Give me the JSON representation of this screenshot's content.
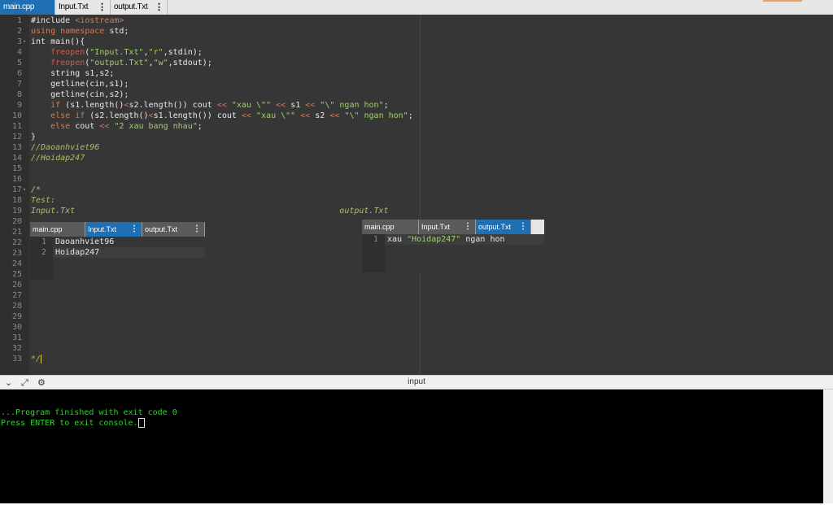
{
  "tabs": [
    {
      "label": "main.cpp",
      "active": true
    },
    {
      "label": "Input.Txt",
      "active": false
    },
    {
      "label": "output.Txt",
      "active": false
    }
  ],
  "menu_glyph": "⋮",
  "editor": {
    "lines": [
      {
        "n": "1",
        "html": "#include <span class='angle'>&lt;iostream&gt;</span>"
      },
      {
        "n": "2",
        "html": "<span class='angle'>using namespace</span> std;"
      },
      {
        "n": "3",
        "html": "int main(){"
      },
      {
        "n": "4",
        "html": "    <span class='red'>freopen</span>(<span class='str'>\"Input.Txt\"</span>,<span class='str'>\"r\"</span>,stdin);"
      },
      {
        "n": "5",
        "html": "    <span class='red'>freopen</span>(<span class='str'>\"output.Txt\"</span>,<span class='str'>\"w\"</span>,stdout);"
      },
      {
        "n": "6",
        "html": "    string s1,s2;"
      },
      {
        "n": "7",
        "html": "    getline(cin,s1);"
      },
      {
        "n": "8",
        "html": "    getline(cin,s2);"
      },
      {
        "n": "9",
        "html": "    <span class='angle'>if</span> (s1.length()<span class='angle'>&lt;</span>s2.length()) cout <span class='angle'>&lt;&lt;</span> <span class='str'>\"xau \\\"\"</span> <span class='angle'>&lt;&lt;</span> s1 <span class='angle'>&lt;&lt;</span> <span class='str'>\"\\\" ngan hon\"</span>;"
      },
      {
        "n": "10",
        "html": "    <span class='angle'>else if</span> (s2.length()<span class='angle'>&lt;</span>s1.length()) cout <span class='angle'>&lt;&lt;</span> <span class='str'>\"xau \\\"\"</span> <span class='angle'>&lt;&lt;</span> s2 <span class='angle'>&lt;&lt;</span> <span class='str'>\"\\\" ngan hon\"</span>;"
      },
      {
        "n": "11",
        "html": "    <span class='angle'>else</span> cout <span class='angle'>&lt;&lt;</span> <span class='str'>\"2 xau bang nhau\"</span>;"
      },
      {
        "n": "12",
        "html": "}"
      },
      {
        "n": "13",
        "html": "<span class='cm'>//Daoanhviet96</span>"
      },
      {
        "n": "14",
        "html": "<span class='cm'>//Hoidap247</span>"
      },
      {
        "n": "15",
        "html": ""
      },
      {
        "n": "16",
        "html": ""
      },
      {
        "n": "17",
        "html": "<span class='cm'>/*</span>"
      },
      {
        "n": "18",
        "html": "<span class='cm'>Test:</span>"
      },
      {
        "n": "19",
        "html": "<span class='cm'>Input.Txt</span>                                                      <span class='cm'>output.Txt</span>"
      },
      {
        "n": "20",
        "html": ""
      },
      {
        "n": "21",
        "html": ""
      },
      {
        "n": "22",
        "html": ""
      },
      {
        "n": "23",
        "html": ""
      },
      {
        "n": "24",
        "html": ""
      },
      {
        "n": "25",
        "html": ""
      },
      {
        "n": "26",
        "html": ""
      },
      {
        "n": "27",
        "html": ""
      },
      {
        "n": "28",
        "html": ""
      },
      {
        "n": "29",
        "html": ""
      },
      {
        "n": "30",
        "html": ""
      },
      {
        "n": "31",
        "html": ""
      },
      {
        "n": "32",
        "html": ""
      },
      {
        "n": "33",
        "html": "<span class='cm'>*/</span><span class='cursor'></span>"
      }
    ],
    "folds": [
      "3",
      "17"
    ]
  },
  "input_window": {
    "tabs": [
      {
        "label": "main.cpp",
        "state": "dark"
      },
      {
        "label": "Input.Txt",
        "state": "active"
      },
      {
        "label": "output.Txt",
        "state": "dark"
      }
    ],
    "lines": [
      {
        "n": "1",
        "text": "Daoanhviet96"
      },
      {
        "n": "2",
        "text": "Hoidap247"
      }
    ]
  },
  "output_window": {
    "tabs": [
      {
        "label": "main.cpp",
        "state": "dark"
      },
      {
        "label": "Input.Txt",
        "state": "dark"
      },
      {
        "label": "output.Txt",
        "state": "active"
      }
    ],
    "lines": [
      {
        "n": "1",
        "prefix": "xau ",
        "quoted": "\"Hoidap247\"",
        "suffix": " ngan hon"
      }
    ]
  },
  "console": {
    "title": "input",
    "lines": [
      "...Program finished with exit code 0",
      "Press ENTER to exit console."
    ]
  }
}
